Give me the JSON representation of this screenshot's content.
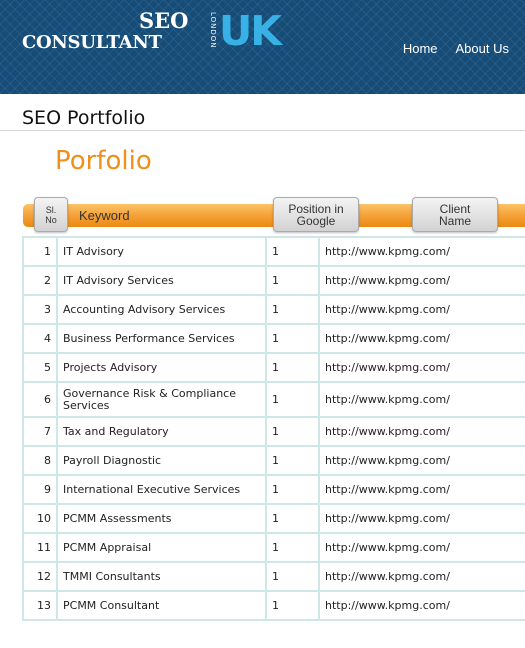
{
  "logo": {
    "seo": "SEO",
    "consultant": "CONSULTANT",
    "london": "LONDON",
    "uk": "UK"
  },
  "nav": {
    "items": [
      "Home",
      "About Us"
    ]
  },
  "page_title": "SEO Portfolio",
  "section_title": "Porfolio",
  "columns": {
    "sl": "Sl. No",
    "keyword": "Keyword",
    "position": "Position in Google",
    "client": "Client Name"
  },
  "rows": [
    {
      "sl": "1",
      "keyword": "IT Advisory",
      "position": "1",
      "client": "http://www.kpmg.com/"
    },
    {
      "sl": "2",
      "keyword": "IT Advisory Services",
      "position": "1",
      "client": "http://www.kpmg.com/"
    },
    {
      "sl": "3",
      "keyword": "Accounting Advisory Services",
      "position": "1",
      "client": "http://www.kpmg.com/"
    },
    {
      "sl": "4",
      "keyword": "Business Performance Services",
      "position": "1",
      "client": "http://www.kpmg.com/"
    },
    {
      "sl": "5",
      "keyword": "Projects Advisory",
      "position": "1",
      "client": "http://www.kpmg.com/"
    },
    {
      "sl": "6",
      "keyword": "Governance Risk & Compliance Services",
      "position": "1",
      "client": "http://www.kpmg.com/"
    },
    {
      "sl": "7",
      "keyword": "Tax and Regulatory",
      "position": "1",
      "client": "http://www.kpmg.com/"
    },
    {
      "sl": "8",
      "keyword": "Payroll Diagnostic",
      "position": "1",
      "client": "http://www.kpmg.com/"
    },
    {
      "sl": "9",
      "keyword": "International Executive Services",
      "position": "1",
      "client": "http://www.kpmg.com/"
    },
    {
      "sl": "10",
      "keyword": "PCMM Assessments",
      "position": "1",
      "client": "http://www.kpmg.com/"
    },
    {
      "sl": "11",
      "keyword": "PCMM Appraisal",
      "position": "1",
      "client": "http://www.kpmg.com/"
    },
    {
      "sl": "12",
      "keyword": "TMMI Consultants",
      "position": "1",
      "client": "http://www.kpmg.com/"
    },
    {
      "sl": "13",
      "keyword": "PCMM Consultant",
      "position": "1",
      "client": "http://www.kpmg.com/"
    }
  ],
  "colors": {
    "header_bg": "#164c78",
    "logo_accent": "#38b2e6",
    "title_orange": "#f0901c",
    "bar_orange": "#f5a137",
    "grid_border": "#cde8e6"
  }
}
